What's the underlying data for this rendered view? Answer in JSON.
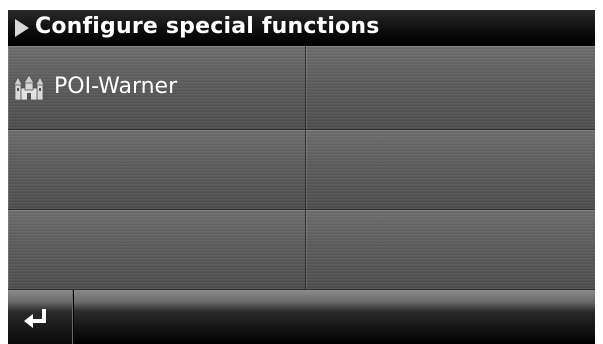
{
  "header": {
    "title": "Configure special functions",
    "arrow_icon": "play-arrow-icon"
  },
  "grid": {
    "items": [
      {
        "label": "POI-Warner",
        "icon": "castle-icon"
      },
      {
        "label": ""
      },
      {
        "label": ""
      },
      {
        "label": ""
      },
      {
        "label": ""
      },
      {
        "label": ""
      }
    ]
  },
  "footer": {
    "back_icon": "return-arrow-icon"
  },
  "colors": {
    "tile": "#5e5e5e",
    "titlebar": "#000000",
    "text": "#ffffff"
  }
}
